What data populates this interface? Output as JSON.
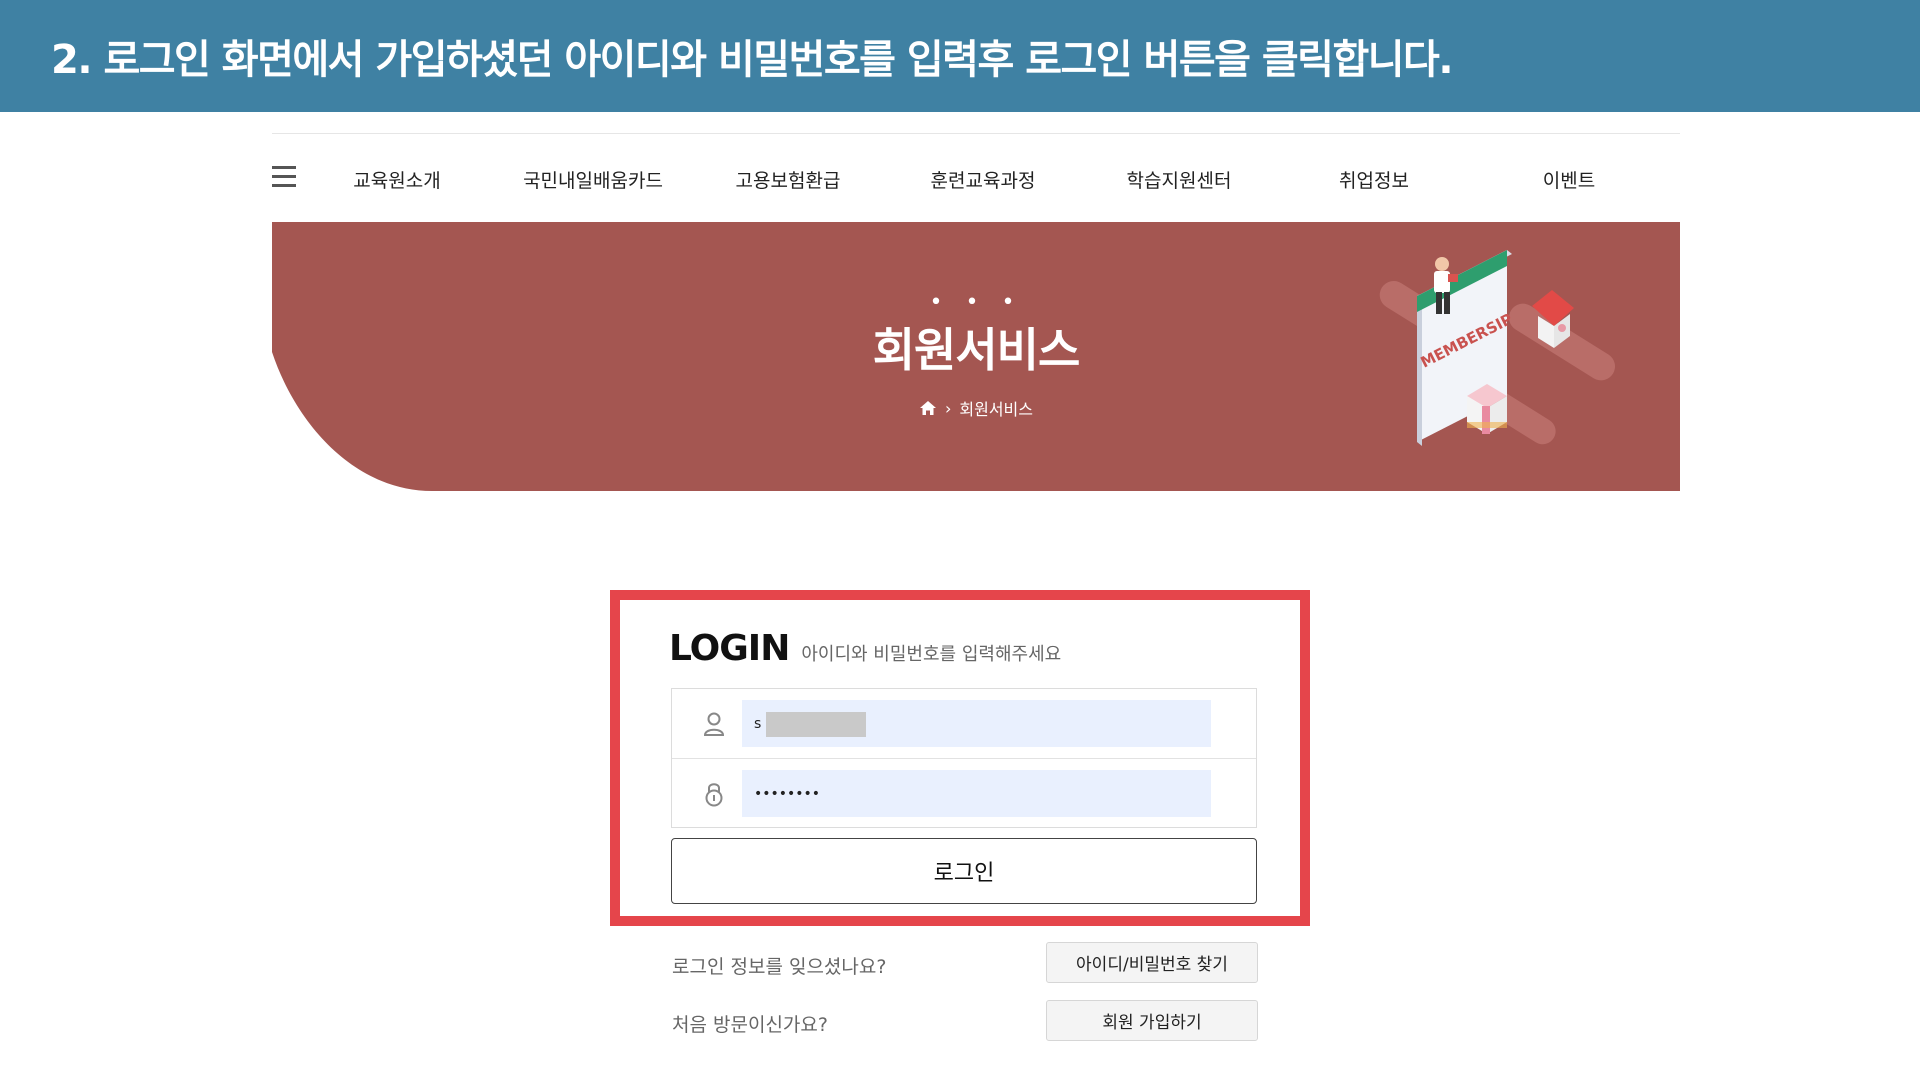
{
  "banner": {
    "instruction": "2. 로그인 화면에서 가입하셨던 아이디와 비밀번호를 입력후 로그인 버튼을 클릭합니다."
  },
  "nav": {
    "menu_icon": "hamburger-menu-icon",
    "items": [
      "교육원소개",
      "국민내일배움카드",
      "고용보험환급",
      "훈련교육과정",
      "학습지원센터",
      "취업정보",
      "이벤트"
    ]
  },
  "hero": {
    "dots": "• • •",
    "title": "회원서비스",
    "breadcrumb_home_icon": "home-icon",
    "breadcrumb_separator": "›",
    "breadcrumb_current": "회원서비스",
    "illustration_text": "MEMBERSIP"
  },
  "login": {
    "title": "LOGIN",
    "subtitle": "아이디와 비밀번호를 입력해주세요",
    "username_value": "s",
    "password_value": "••••••••",
    "submit_label": "로그인"
  },
  "help": {
    "forgot_text": "로그인 정보를 잊으셨나요?",
    "forgot_button": "아이디/비밀번호 찾기",
    "signup_text": "처음 방문이신가요?",
    "signup_button": "회원 가입하기"
  },
  "colors": {
    "banner": "#3f81a3",
    "hero_background": "#a45651",
    "highlight_border": "#e5454b",
    "input_background": "#e9f0fe"
  }
}
